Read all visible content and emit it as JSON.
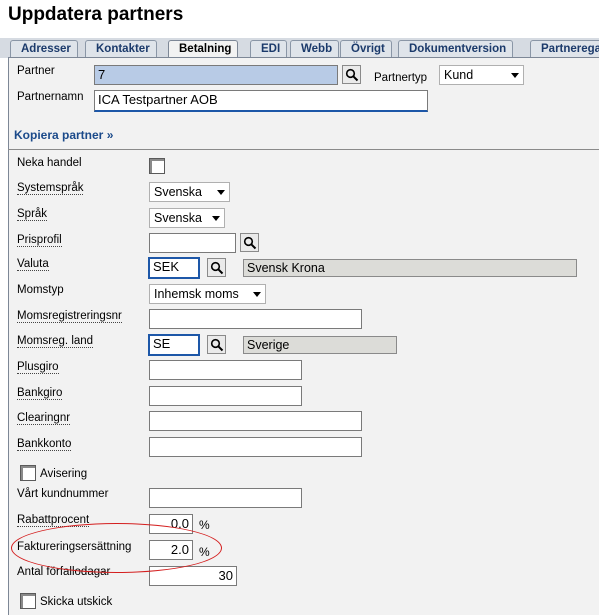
{
  "page_title": "Uppdatera partners",
  "tabs": [
    "Adresser",
    "Kontakter",
    "Betalning",
    "EDI",
    "Webb",
    "Övrigt",
    "Dokumentversion",
    "Partnerega"
  ],
  "active_tab": "Betalning",
  "partner": {
    "partner_label": "Partner",
    "partner_value": "7",
    "partnertyp_label": "Partnertyp",
    "partnertyp_value": "Kund",
    "partnernamn_label": "Partnernamn",
    "partnernamn_value": "ICA Testpartner AOB",
    "kopiera_link": "Kopiera partner »"
  },
  "form": {
    "neka_handel_label": "Neka handel",
    "systemsprak_label": "Systemspråk",
    "systemsprak_value": "Svenska",
    "sprak_label": "Språk",
    "sprak_value": "Svenska",
    "prisprofil_label": "Prisprofil",
    "prisprofil_value": "",
    "valuta_label": "Valuta",
    "valuta_code": "SEK",
    "valuta_name": "Svensk Krona",
    "momstyp_label": "Momstyp",
    "momstyp_value": "Inhemsk moms",
    "momsregnr_label": "Momsregistreringsnr",
    "momsregnr_value": "",
    "momsreg_land_label": "Momsreg. land",
    "momsreg_land_code": "SE",
    "momsreg_land_name": "Sverige",
    "plusgiro_label": "Plusgiro",
    "bankgiro_label": "Bankgiro",
    "clearingnr_label": "Clearingnr",
    "bankkonto_label": "Bankkonto",
    "avisering_label": "Avisering",
    "vart_kundnummer_label": "Vårt kundnummer",
    "rabattprocent_label": "Rabattprocent",
    "rabattprocent_value": "0.0",
    "fakturering_label": "Faktureringsersättning",
    "fakturering_value": "2.0",
    "percent_unit": "%",
    "antal_label": "Antal förfallodagar",
    "antal_value": "30",
    "skicka_utskick_label": "Skicka utskick"
  }
}
